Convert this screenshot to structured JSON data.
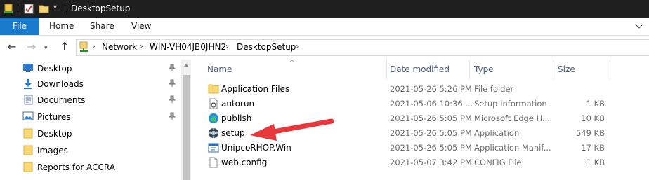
{
  "window": {
    "title": "DesktopSetup"
  },
  "ribbon": {
    "tabs": [
      "File",
      "Home",
      "Share",
      "View"
    ]
  },
  "address": {
    "breadcrumbs": [
      "Network",
      "WIN-VH04JB0JHN2",
      "DesktopSetup"
    ]
  },
  "nav_pane": {
    "items": [
      {
        "label": "Desktop",
        "icon": "desktop-blue-icon",
        "pinned": true
      },
      {
        "label": "Downloads",
        "icon": "download-arrow-icon",
        "pinned": true
      },
      {
        "label": "Documents",
        "icon": "documents-icon",
        "pinned": true
      },
      {
        "label": "Pictures",
        "icon": "pictures-icon",
        "pinned": true
      },
      {
        "label": "Desktop",
        "icon": "folder-icon",
        "pinned": false
      },
      {
        "label": "Images",
        "icon": "folder-icon",
        "pinned": false
      },
      {
        "label": "Reports for ACCRA",
        "icon": "folder-icon",
        "pinned": false
      }
    ]
  },
  "details": {
    "columns": [
      "Name",
      "Date modified",
      "Type",
      "Size"
    ],
    "rows": [
      {
        "name": "Application Files",
        "date": "2021-05-26 5:26 PM",
        "type": "File folder",
        "size": "",
        "icon": "folder-icon"
      },
      {
        "name": "autorun",
        "date": "2021-05-06 10:36 ...",
        "type": "Setup Information",
        "size": "1 KB",
        "icon": "setup-info-file-icon"
      },
      {
        "name": "publish",
        "date": "2021-05-26 5:05 PM",
        "type": "Microsoft Edge H...",
        "size": "10 KB",
        "icon": "edge-icon"
      },
      {
        "name": "setup",
        "date": "2021-05-26 5:05 PM",
        "type": "Application",
        "size": "549 KB",
        "icon": "setup-app-icon"
      },
      {
        "name": "UnipcoRHOP.Win",
        "date": "2021-05-26 5:05 PM",
        "type": "Application Manif...",
        "size": "17 KB",
        "icon": "app-manifest-icon"
      },
      {
        "name": "web.config",
        "date": "2021-05-07 3:42 PM",
        "type": "CONFIG File",
        "size": "1 KB",
        "icon": "config-file-icon"
      }
    ]
  },
  "colors": {
    "file_tab": "#1979ca",
    "titlebar": "#1f1f1f",
    "arrow": "#e8383c",
    "header_text": "#4c607a"
  }
}
